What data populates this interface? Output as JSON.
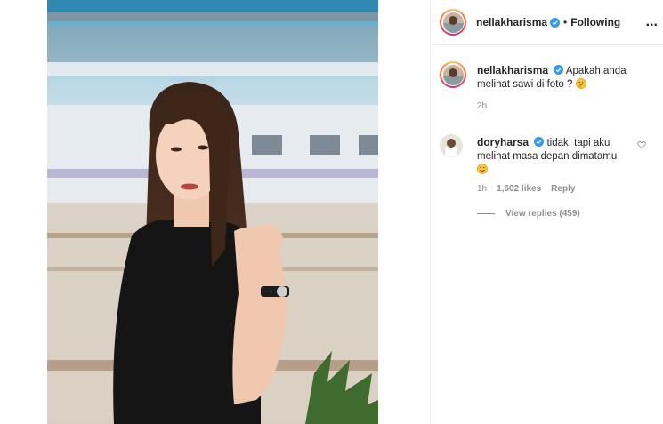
{
  "post": {
    "author": "nellakharisma",
    "follow_status": "Following",
    "dot": "•",
    "more_label": "...",
    "photo_alt": "photo"
  },
  "caption": {
    "author": "nellakharisma",
    "text": "Apakah anda melihat sawi di foto ?",
    "time": "2h"
  },
  "comment": {
    "author": "doryharsa",
    "text": "tidak, tapi aku melihat masa depan dimatamu",
    "time": "1h",
    "likes": "1,602 likes",
    "reply_label": "Reply",
    "view_replies": "View replies (459)"
  },
  "icons": {
    "verified": "verified-badge-icon",
    "heart": "heart-icon",
    "more": "more-options-icon",
    "thinking_emoji": "thinking-face-emoji",
    "smile_emoji": "smiling-face-emoji"
  },
  "colors": {
    "verified": "#3897f0",
    "muted": "#8e8e8e",
    "text": "#262626"
  }
}
